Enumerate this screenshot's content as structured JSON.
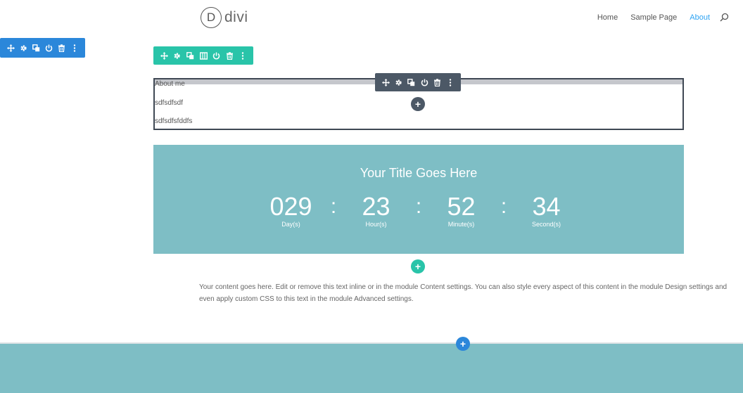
{
  "header": {
    "logo_letter": "D",
    "logo_text": "divi",
    "nav": [
      {
        "label": "Home",
        "active": false
      },
      {
        "label": "Sample Page",
        "active": false
      },
      {
        "label": "About",
        "active": true
      }
    ]
  },
  "toolbars": {
    "section": [
      "move-icon",
      "gear-icon",
      "duplicate-icon",
      "power-icon",
      "trash-icon",
      "more-icon"
    ],
    "row": [
      "move-icon",
      "gear-icon",
      "duplicate-icon",
      "columns-icon",
      "power-icon",
      "trash-icon",
      "more-icon"
    ],
    "module": [
      "move-icon",
      "gear-icon",
      "duplicate-icon",
      "power-icon",
      "trash-icon",
      "more-icon"
    ]
  },
  "text_module": {
    "lines": [
      "About me",
      "sdfsdfsdf",
      "sdfsdfsfddfs"
    ]
  },
  "countdown": {
    "title": "Your Title Goes Here",
    "days": "029",
    "days_label": "Day(s)",
    "hours": "23",
    "hours_label": "Hour(s)",
    "minutes": "52",
    "minutes_label": "Minute(s)",
    "seconds": "34",
    "seconds_label": "Second(s)",
    "separator": ":"
  },
  "paragraph": {
    "text": "Your content goes here. Edit or remove this text inline or in the module Content settings. You can also style every aspect of this content in the module Design settings and even apply custom CSS to this text in the module Advanced settings."
  },
  "add_buttons": {
    "symbol": "+"
  },
  "colors": {
    "section_blue": "#2b87da",
    "row_green": "#29c4a9",
    "module_dark": "#4c5866",
    "countdown_bg": "#7ebec5",
    "nav_active": "#2ea3f2"
  }
}
